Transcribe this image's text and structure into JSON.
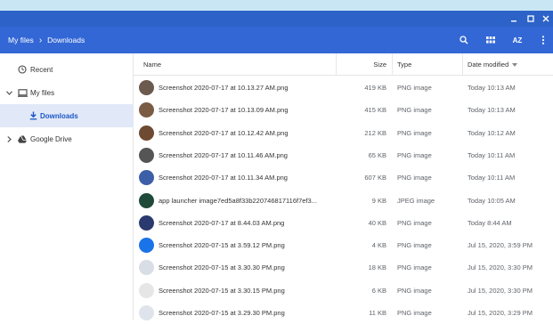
{
  "toolbar": {
    "breadcrumb_root": "My files",
    "breadcrumb_current": "Downloads",
    "sort_button": "AZ"
  },
  "sidebar": {
    "items": [
      {
        "label": "Recent",
        "icon": "clock-icon"
      },
      {
        "label": "My files",
        "icon": "computer-icon"
      },
      {
        "label": "Downloads",
        "icon": "download-icon"
      },
      {
        "label": "Google Drive",
        "icon": "drive-icon"
      }
    ]
  },
  "columns": {
    "name": "Name",
    "size": "Size",
    "type": "Type",
    "date": "Date modified"
  },
  "files": [
    {
      "name": "Screenshot 2020-07-17 at 10.13.27 AM.png",
      "size": "419 KB",
      "type": "PNG image",
      "date": "Today 10:13 AM",
      "thumb": "#6b5a4d"
    },
    {
      "name": "Screenshot 2020-07-17 at 10.13.09 AM.png",
      "size": "415 KB",
      "type": "PNG image",
      "date": "Today 10:13 AM",
      "thumb": "#7a5c45"
    },
    {
      "name": "Screenshot 2020-07-17 at 10.12.42 AM.png",
      "size": "212 KB",
      "type": "PNG image",
      "date": "Today 10:12 AM",
      "thumb": "#6e4a33"
    },
    {
      "name": "Screenshot 2020-07-17 at 10.11.46 AM.png",
      "size": "65 KB",
      "type": "PNG image",
      "date": "Today 10:11 AM",
      "thumb": "#555555"
    },
    {
      "name": "Screenshot 2020-07-17 at 10.11.34 AM.png",
      "size": "607 KB",
      "type": "PNG image",
      "date": "Today 10:11 AM",
      "thumb": "#3d5fa8"
    },
    {
      "name": "app launcher image7ed5a8f33b220746817116f7ef3...",
      "size": "9 KB",
      "type": "JPEG image",
      "date": "Today 10:05 AM",
      "thumb": "#1f4a3a"
    },
    {
      "name": "Screenshot 2020-07-17 at 8.44.03 AM.png",
      "size": "40 KB",
      "type": "PNG image",
      "date": "Today 8:44 AM",
      "thumb": "#2b3a6e"
    },
    {
      "name": "Screenshot 2020-07-15 at 3.59.12 PM.png",
      "size": "4 KB",
      "type": "PNG image",
      "date": "Jul 15, 2020, 3:59 PM",
      "thumb": "#1a73e8"
    },
    {
      "name": "Screenshot 2020-07-15 at 3.30.30 PM.png",
      "size": "18 KB",
      "type": "PNG image",
      "date": "Jul 15, 2020, 3:30 PM",
      "thumb": "#d8dde6"
    },
    {
      "name": "Screenshot 2020-07-15 at 3.30.15 PM.png",
      "size": "6 KB",
      "type": "PNG image",
      "date": "Jul 15, 2020, 3:30 PM",
      "thumb": "#e6e6e6"
    },
    {
      "name": "Screenshot 2020-07-15 at 3.29.30 PM.png",
      "size": "11 KB",
      "type": "PNG image",
      "date": "Jul 15, 2020, 3:29 PM",
      "thumb": "#dfe4ec"
    }
  ],
  "colors": {
    "titlebar": "#2d63c8",
    "toolbar": "#3367d6",
    "selected": "#e1e8f7",
    "accent": "#1a56c8"
  }
}
